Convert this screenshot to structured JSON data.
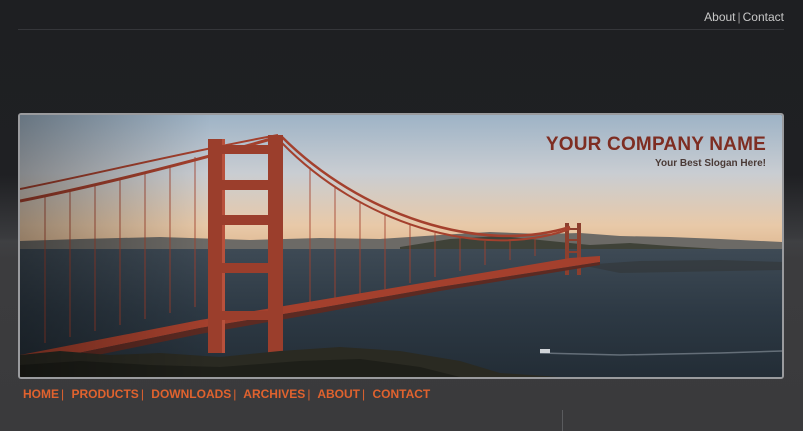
{
  "top_links": {
    "about": "About",
    "contact": "Contact",
    "separator": "|"
  },
  "banner": {
    "company_name": "YOUR COMPANY NAME",
    "slogan": "Your Best Slogan Here!",
    "image_subject": "golden-gate-bridge-photo"
  },
  "nav": {
    "separator": "|",
    "items": [
      {
        "label": "HOME"
      },
      {
        "label": "PRODUCTS"
      },
      {
        "label": "DOWNLOADS"
      },
      {
        "label": "ARCHIVES"
      },
      {
        "label": "ABOUT"
      },
      {
        "label": "CONTACT"
      }
    ]
  },
  "colors": {
    "nav_link": "#e0622e",
    "company_name": "#7e2d22",
    "background": "#1f2023"
  }
}
